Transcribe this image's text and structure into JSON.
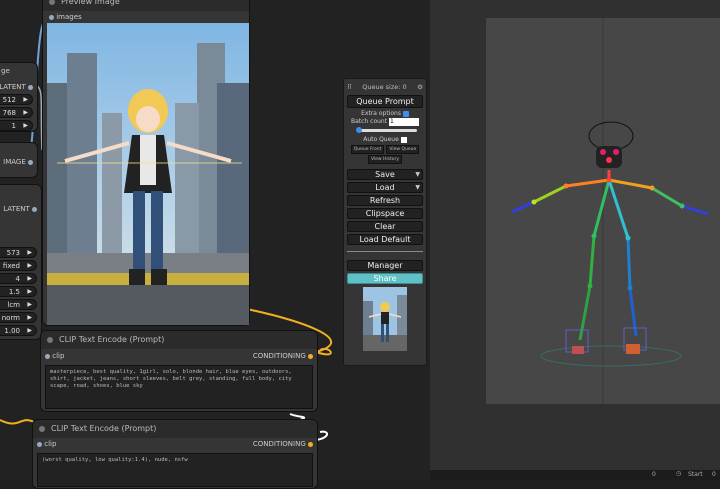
{
  "preview_node": {
    "title": "Preview Image",
    "input": "images"
  },
  "loader_node": {
    "title_fragment": "ge",
    "output_latent": "LATENT",
    "width": "512",
    "height": "768",
    "batch": "1",
    "output_image": "IMAGE"
  },
  "ksampler_node": {
    "input_latent": "LATENT",
    "widgets": [
      "573",
      "fixed",
      "4",
      "1.5",
      "lcm",
      "norm",
      "1.00"
    ]
  },
  "clip_pos": {
    "title": "CLIP Text Encode (Prompt)",
    "input": "clip",
    "output": "CONDITIONING",
    "text": "masterpiece, best quality, 1girl, solo, blonde hair, blue eyes, outdoors, shirt, jacket, jeans, short sleeves, belt grey, standing, full body, city scape, road, shoes, blue sky"
  },
  "clip_neg": {
    "title": "CLIP Text Encode (Prompt)",
    "input": "clip",
    "output": "CONDITIONING",
    "text": "(worst quality, low quality:1.4), nude, nsfw"
  },
  "menu": {
    "queue_size": "Queue size: 0",
    "queue_prompt": "Queue Prompt",
    "extra_options": "Extra options",
    "batch_count": "Batch count",
    "batch_count_value": "1",
    "auto_queue": "Auto Queue",
    "view_front": "Queue Front",
    "view_queue": "View Queue",
    "view_history": "View History",
    "save": "Save",
    "load": "Load",
    "refresh": "Refresh",
    "clipspace": "Clipspace",
    "clear": "Clear",
    "load_default": "Load Default",
    "manager": "Manager",
    "share": "Share"
  },
  "bottombar": {
    "value1": "0",
    "start_label": "Start",
    "value2": "0"
  },
  "colors": {
    "share": "#5fc0c6",
    "wire_yellow": "#f0b020",
    "wire_blue": "#6fa0d8"
  }
}
